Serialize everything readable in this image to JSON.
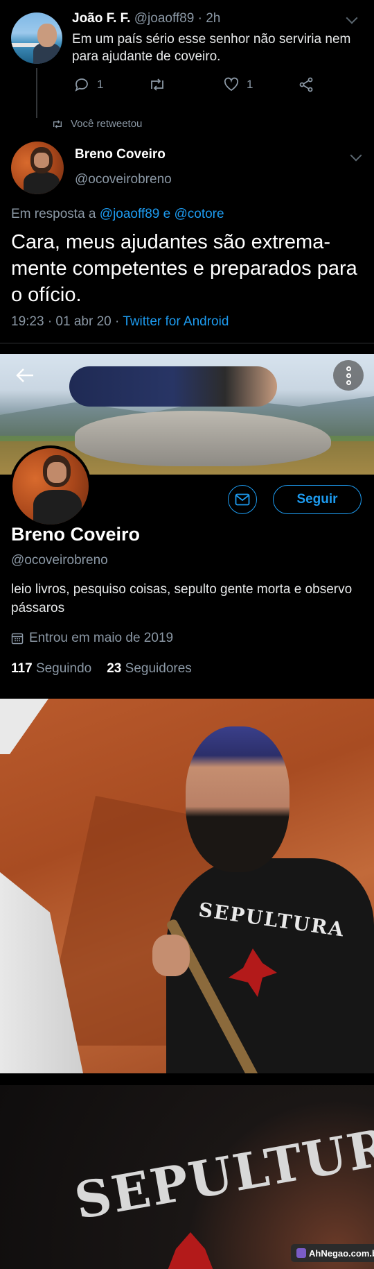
{
  "tweet1": {
    "name": "João F. F.",
    "handle": "@joaoff89",
    "time": "· 2h",
    "text": "Em um país sério esse senhor não serviria nem para ajudante de coveiro.",
    "reply_count": "1",
    "like_count": "1"
  },
  "retweet_notice": "Você retweetou",
  "tweet2": {
    "name": "Breno Coveiro",
    "handle": "@ocoveirobreno",
    "reply_prefix": "Em resposta a",
    "reply_user1": "@joaoff89",
    "reply_and": "e",
    "reply_user2": "@cotore",
    "text": "Cara, meus ajudantes são extrema-mente competentes e preparados para o ofício.",
    "time": "19:23 · 01 abr 20 ·",
    "source": "Twitter for Android"
  },
  "profile": {
    "follow_label": "Seguir",
    "name": "Breno Coveiro",
    "handle": "@ocoveirobreno",
    "bio": "leio livros, pesquiso coisas, sepulto gente morta e observo pássaros",
    "joined": "Entrou em maio de 2019",
    "following_count": "117",
    "following_label": "Seguindo",
    "followers_count": "23",
    "followers_label": "Seguidores"
  },
  "photos": {
    "shirt_text_1": "SEPULTURA",
    "shirt_text_2": "SEPULTURA"
  },
  "watermark": "AhNegao.com.br",
  "colors": {
    "background": "#000000",
    "accent": "#1d9bf0",
    "muted": "#8b98a5"
  },
  "icons": [
    "reply-icon",
    "retweet-icon",
    "like-icon",
    "share-icon",
    "back-arrow-icon",
    "more-icon",
    "mail-icon",
    "calendar-icon",
    "chevron-down-icon"
  ]
}
